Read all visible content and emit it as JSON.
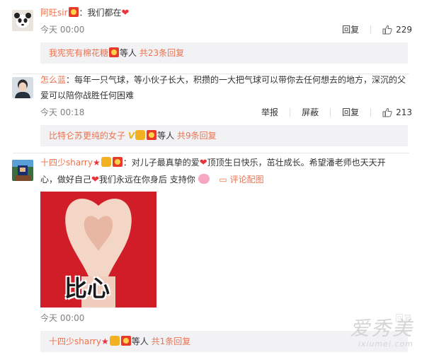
{
  "comments": [
    {
      "username": "阿旺sir",
      "text": "：我们都在",
      "time": "今天 00:00",
      "reply_label": "回复",
      "likes": "229",
      "thread": {
        "user": "我宪宪有棉花糖",
        "middle": "等人",
        "count": "共23条回复"
      }
    },
    {
      "username": "怎么蓝",
      "text_line1": "：每年一只气球，等小伙子长大，积攒的一大把气球可以带你去任何想去的地方，深沉的父",
      "text_line2": "爱可以陪你战胜任何困难",
      "time": "今天 00:18",
      "report_label": "举报",
      "block_label": "屏蔽",
      "reply_label": "回复",
      "likes": "213",
      "thread": {
        "user": "比特仑苏更纯的女子",
        "v_mark": "V",
        "middle": "等人",
        "count": "共9条回复"
      }
    },
    {
      "username": "十四少sharry",
      "text_line1a": "：对儿子最真挚的爱",
      "text_line1b": "顶顶生日快乐，茁壮成长。希望潘老师也天天开",
      "text_line2a": "心，做好自己",
      "text_line2b": "我们永远在你身后 支持你",
      "pic_link": "评论配图",
      "image_caption": "比心",
      "time": "今天 00:00",
      "reply_label": "回复",
      "thread": {
        "user": "十四少sharry",
        "middle": "等人",
        "count": "共1条回复"
      }
    }
  ],
  "watermark": {
    "cn": "爱秀美",
    "en": "ixiumei.com"
  },
  "colors": {
    "username": "#eb7350",
    "reply_box_bg": "#f2f2f5",
    "heart": "#e8353b"
  }
}
